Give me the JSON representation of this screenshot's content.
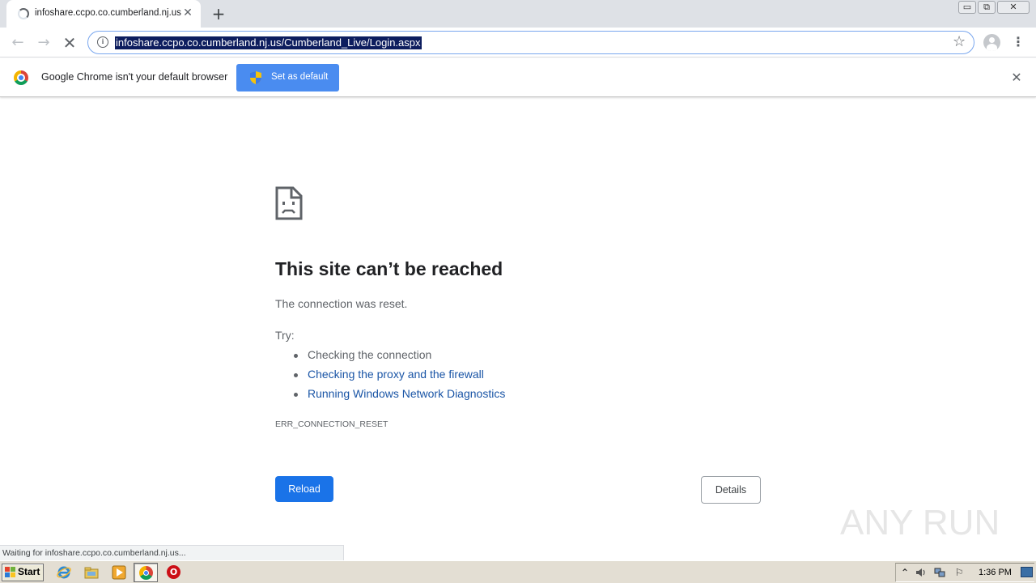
{
  "browser": {
    "tab": {
      "title": "infoshare.ccpo.co.cumberland.nj.us",
      "close_icon": "close-icon"
    },
    "new_tab_glyph": "+",
    "window_controls": {
      "minimize": "▭",
      "restore": "⧉",
      "close": "✕"
    },
    "toolbar": {
      "back_glyph": "←",
      "forward_glyph": "→",
      "stop_glyph": "✕",
      "url": "infoshare.ccpo.co.cumberland.nj.us/Cumberland_Live/Login.aspx",
      "info_glyph": "i",
      "star_glyph": "☆",
      "menu_glyph": "⋮"
    },
    "infobar": {
      "message": "Google Chrome isn't your default browser",
      "button_label": "Set as default",
      "close_glyph": "✕"
    }
  },
  "error_page": {
    "title": "This site can’t be reached",
    "subtitle": "The connection was reset.",
    "try_label": "Try:",
    "suggestions": [
      "Checking the connection",
      "Checking the proxy and the firewall",
      "Running Windows Network Diagnostics"
    ],
    "error_code": "ERR_CONNECTION_RESET",
    "reload_label": "Reload",
    "details_label": "Details"
  },
  "status_bubble": "Waiting for infoshare.ccpo.co.cumberland.nj.us...",
  "watermark": "ANY RUN",
  "taskbar": {
    "start_label": "Start",
    "opera_glyph": "O",
    "tray": {
      "arrow_glyph": "⌃",
      "volume_glyph": "🔊",
      "flag_glyph": "⚐"
    },
    "clock": "1:36 PM"
  },
  "colors": {
    "accent_blue": "#1a73e8",
    "link_blue": "#1a55a6",
    "infobar_button": "#4a8cf0",
    "url_highlight": "#0d1d5e"
  }
}
